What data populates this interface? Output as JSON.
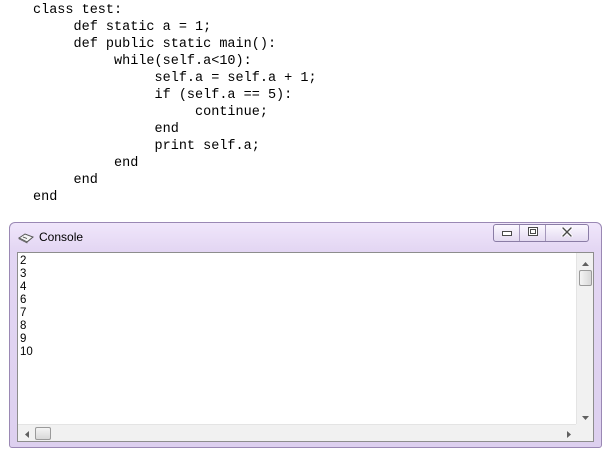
{
  "code": {
    "lines": [
      "class test:",
      "     def static a = 1;",
      "     def public static main():",
      "          while(self.a<10):",
      "               self.a = self.a + 1;",
      "               if (self.a == 5):",
      "                    continue;",
      "               end",
      "               print self.a;",
      "          end",
      "     end",
      "end"
    ]
  },
  "console": {
    "title": "Console",
    "icon": "console-icon",
    "controls": [
      "minimize-icon",
      "maximize-icon",
      "close-icon"
    ],
    "output": [
      "2",
      "3",
      "4",
      "6",
      "7",
      "8",
      "9",
      "10"
    ]
  },
  "colors": {
    "titlebar": "#e3d6f3",
    "border": "#9a88b4",
    "text": "#000000"
  }
}
